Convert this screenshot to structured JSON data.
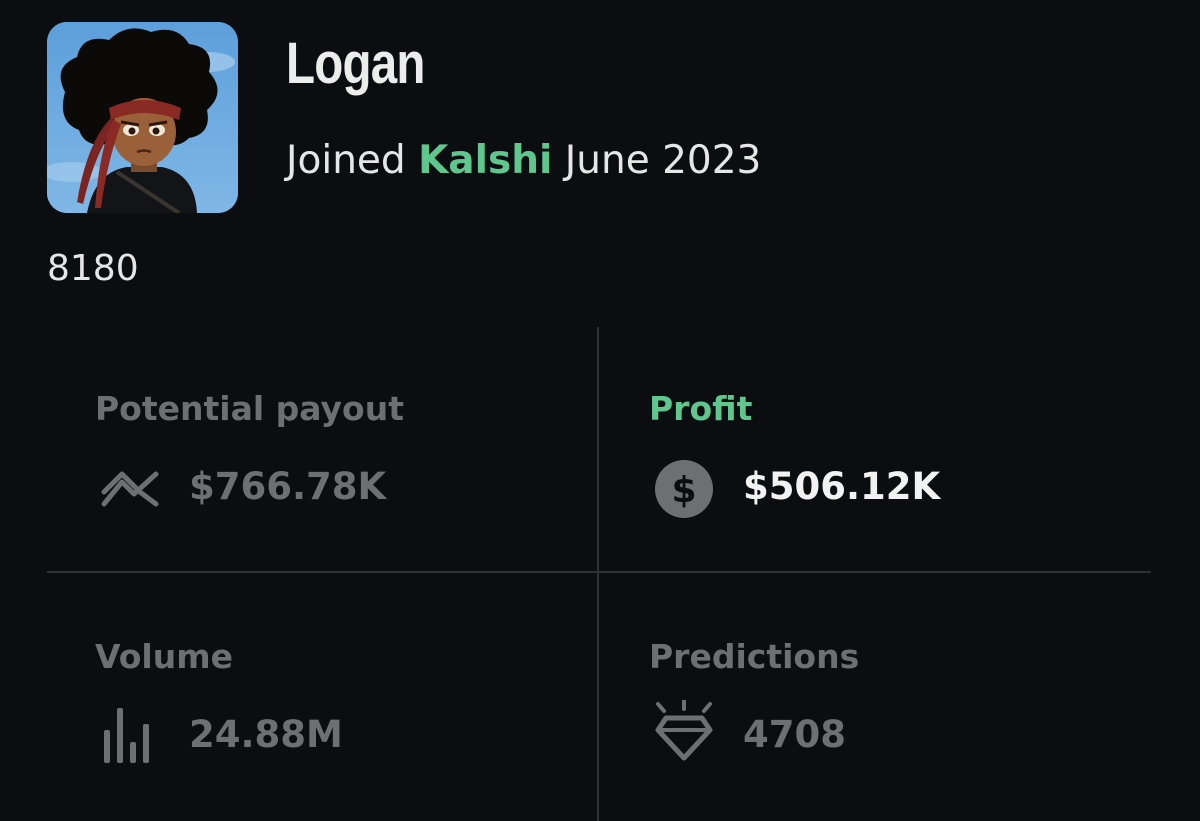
{
  "profile": {
    "username": "Logan",
    "joined_prefix": "Joined",
    "platform": "Kalshi",
    "joined_date": "June 2023",
    "rank": "8180",
    "avatar_icon": "cartoon-avatar-icon"
  },
  "stats": {
    "potential_payout": {
      "label": "Potential payout",
      "value": "$766.78K",
      "icon": "trend-arrow-icon"
    },
    "profit": {
      "label": "Profit",
      "value": "$506.12K",
      "icon": "dollar-coin-icon"
    },
    "volume": {
      "label": "Volume",
      "value": "24.88M",
      "icon": "bar-chart-icon"
    },
    "predictions": {
      "label": "Predictions",
      "value": "4708",
      "icon": "diamond-icon"
    }
  },
  "colors": {
    "background": "#0c0d11",
    "accent_green": "#5fc68e",
    "muted_text": "#6e6f73",
    "primary_text": "#ececec",
    "divider": "#2f3034"
  }
}
